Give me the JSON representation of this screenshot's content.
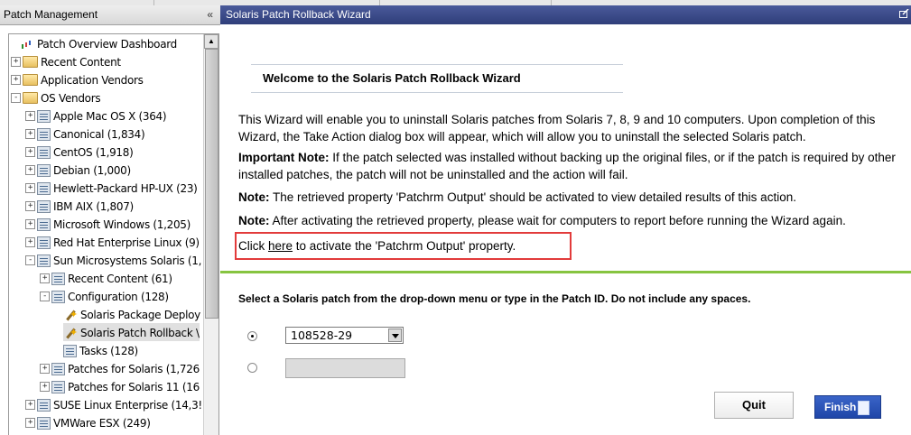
{
  "left_panel": {
    "title": "Patch Management",
    "collapse_icon": "«",
    "tree": [
      {
        "label": "Patch Overview Dashboard",
        "icon": "dashboard-icon",
        "expander": ""
      },
      {
        "label": "Recent Content",
        "icon": "folder-icon",
        "expander": "+"
      },
      {
        "label": "Application Vendors",
        "icon": "folder-icon",
        "expander": "+"
      },
      {
        "label": "OS Vendors",
        "icon": "folder-icon",
        "expander": "-"
      },
      {
        "label": "Apple Mac OS X (364)",
        "icon": "list-icon",
        "expander": "+"
      },
      {
        "label": "Canonical (1,834)",
        "icon": "list-icon",
        "expander": "+"
      },
      {
        "label": "CentOS (1,918)",
        "icon": "list-icon",
        "expander": "+"
      },
      {
        "label": "Debian (1,000)",
        "icon": "list-icon",
        "expander": "+"
      },
      {
        "label": "Hewlett-Packard HP-UX (23)",
        "icon": "list-icon",
        "expander": "+"
      },
      {
        "label": "IBM AIX (1,807)",
        "icon": "list-icon",
        "expander": "+"
      },
      {
        "label": "Microsoft Windows (1,205)",
        "icon": "list-icon",
        "expander": "+"
      },
      {
        "label": "Red Hat Enterprise Linux (9)",
        "icon": "list-icon",
        "expander": "+"
      },
      {
        "label": "Sun Microsystems Solaris (1,",
        "icon": "list-icon",
        "expander": "-"
      },
      {
        "label": "Recent Content (61)",
        "icon": "list-icon",
        "expander": "+"
      },
      {
        "label": "Configuration (128)",
        "icon": "list-icon",
        "expander": "-"
      },
      {
        "label": "Solaris Package Deploy",
        "icon": "wizard-icon",
        "expander": ""
      },
      {
        "label": "Solaris Patch Rollback \\",
        "icon": "wizard-icon",
        "expander": ""
      },
      {
        "label": "Tasks (128)",
        "icon": "list-icon",
        "expander": ""
      },
      {
        "label": "Patches for Solaris (1,726",
        "icon": "list-icon",
        "expander": "+"
      },
      {
        "label": "Patches for Solaris 11 (16",
        "icon": "list-icon",
        "expander": "+"
      },
      {
        "label": "SUSE Linux Enterprise (14,3!",
        "icon": "list-icon",
        "expander": "+"
      },
      {
        "label": "VMWare ESX (249)",
        "icon": "list-icon",
        "expander": "+"
      }
    ]
  },
  "wizard": {
    "title": "Solaris Patch Rollback Wizard",
    "welcome": "Welcome to the Solaris Patch Rollback Wizard",
    "intro": "This Wizard will enable you to uninstall Solaris patches from Solaris 7, 8, 9 and 10 computers. Upon completion of this Wizard, the Take Action dialog box will appear, which will allow you to uninstall the selected Solaris patch.",
    "important_label": "Important Note:",
    "important_text": " If the patch selected was installed without backing up the original files, or if the patch is required by other installed patches, the patch will not be uninstalled and the action will fail.",
    "note1_label": "Note:",
    "note1_text": " The retrieved property 'Patchrm Output' should be activated to view detailed results of this action.",
    "note2_label": "Note:",
    "note2_text": " After activating the retrieved property, please wait for computers to report before running the Wizard again.",
    "click_prefix": "Click ",
    "click_link": "here",
    "click_suffix": " to activate the 'Patchrm Output' property.",
    "select_instruction": "Select a Solaris patch from the drop-down menu or type in the Patch ID. Do not include any spaces.",
    "patch_dropdown_value": "108528-29",
    "patch_input_value": "",
    "quit_label": "Quit",
    "finish_label": "Finish"
  },
  "colors": {
    "wizard_header": "#2f3e7a",
    "accent_green": "#86c440",
    "highlight_red": "#e23b3b",
    "finish_button": "#1f46a8"
  }
}
